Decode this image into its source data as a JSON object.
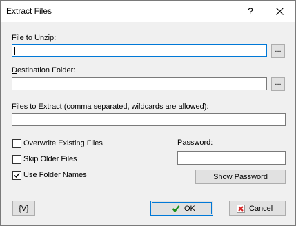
{
  "window": {
    "title": "Extract Files",
    "help_label": "?"
  },
  "file_to_unzip": {
    "label": "File to Unzip:",
    "value": "",
    "browse_label": "..."
  },
  "destination_folder": {
    "label": "Destination Folder:",
    "value": "",
    "browse_label": "..."
  },
  "files_to_extract": {
    "label": "Files to Extract (comma separated, wildcards are allowed):",
    "value": ""
  },
  "options": {
    "overwrite": {
      "label": "Overwrite Existing Files",
      "checked": false
    },
    "skip_older": {
      "label": "Skip Older Files",
      "checked": false
    },
    "use_folder_names": {
      "label": "Use Folder Names",
      "checked": true
    }
  },
  "password": {
    "label": "Password:",
    "value": "",
    "show_label": "Show Password"
  },
  "footer": {
    "variables_label": "{V}",
    "ok_label": "OK",
    "cancel_label": "Cancel",
    "ok_icon_color": "#1a8f1a",
    "cancel_icon_color": "#d42020"
  }
}
